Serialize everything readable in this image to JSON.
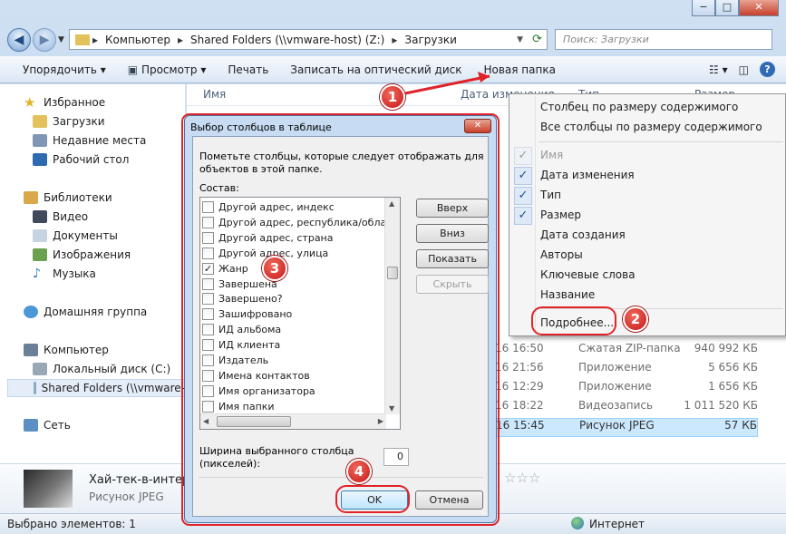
{
  "window": {
    "min": "−",
    "max": "□",
    "close": "✕"
  },
  "nav": {
    "back": "◀",
    "forward": "▶"
  },
  "address": {
    "parts": [
      "Компьютер",
      "Shared Folders (\\\\vmware-host) (Z:)",
      "Загрузки"
    ],
    "sep": "▸"
  },
  "search": {
    "placeholder": "Поиск: Загрузки"
  },
  "toolbar": {
    "organize": "Упорядочить",
    "preview": "Просмотр",
    "print": "Печать",
    "burn": "Записать на оптический диск",
    "newfolder": "Новая папка"
  },
  "sidebar": {
    "favorites": "Избранное",
    "downloads": "Загрузки",
    "recent": "Недавние места",
    "desktop": "Рабочий стол",
    "libraries": "Библиотеки",
    "video": "Видео",
    "documents": "Документы",
    "images": "Изображения",
    "music": "Музыка",
    "homegroup": "Домашняя группа",
    "computer": "Компьютер",
    "localdisk": "Локальный диск (C:)",
    "shared": "Shared Folders (\\\\vmware-",
    "network": "Сеть"
  },
  "columns": {
    "name": "Имя",
    "date": "Дата изменения",
    "type": "Тип",
    "size": "Размер"
  },
  "rows": [
    {
      "date": "16 16:50",
      "type": "Сжатая ZIP-папка",
      "size": "940 992 КБ"
    },
    {
      "date": "16 21:56",
      "type": "Приложение",
      "size": "5 656 КБ"
    },
    {
      "date": "16 12:29",
      "type": "Приложение",
      "size": "1 656 КБ"
    },
    {
      "date": "16 18:22",
      "type": "Видеозапись",
      "size": "1 011 520 КБ"
    },
    {
      "date": "16 15:45",
      "type": "Рисунок JPEG",
      "size": "57 КБ"
    }
  ],
  "details": {
    "filename": "Хай-тек-в-интерь",
    "filetype": "Рисунок JPEG",
    "stars": "☆☆☆"
  },
  "status": {
    "selected": "Выбрано элементов: 1",
    "zone": "Интернет"
  },
  "context_menu": {
    "items": [
      "Столбец по размеру содержимого",
      "Все столбцы по размеру содержимого",
      "Имя",
      "Дата изменения",
      "Тип",
      "Размер",
      "Дата создания",
      "Авторы",
      "Ключевые слова",
      "Название",
      "Подробнее..."
    ],
    "check": "✓"
  },
  "dialog": {
    "title": "Выбор столбцов в таблице",
    "close": "✕",
    "instruction1": "Пометьте столбцы, которые следует отображать для",
    "instruction2": "объектов в этой папке.",
    "composition": "Состав:",
    "items": [
      {
        "label": "Другой адрес, индекс",
        "checked": false
      },
      {
        "label": "Другой адрес, республика/область/к",
        "checked": false
      },
      {
        "label": "Другой адрес, страна",
        "checked": false
      },
      {
        "label": "Другой адрес, улица",
        "checked": false
      },
      {
        "label": "Жанр",
        "checked": true
      },
      {
        "label": "Завершена",
        "checked": false
      },
      {
        "label": "Завершено?",
        "checked": false
      },
      {
        "label": "Зашифровано",
        "checked": false
      },
      {
        "label": "ИД альбома",
        "checked": false
      },
      {
        "label": "ИД клиента",
        "checked": false
      },
      {
        "label": "Издатель",
        "checked": false
      },
      {
        "label": "Имена контактов",
        "checked": false
      },
      {
        "label": "Имя организатора",
        "checked": false
      },
      {
        "label": "Имя папки",
        "checked": false
      }
    ],
    "up": "Вверх",
    "down": "Вниз",
    "show": "Показать",
    "hide": "Скрыть",
    "width_label1": "Ширина выбранного столбца",
    "width_label2": "(пикселей):",
    "width_value": "0",
    "ok": "OK",
    "cancel": "Отмена"
  },
  "badges": [
    "1",
    "2",
    "3",
    "4"
  ],
  "colors": {
    "badge": "#d9252a",
    "ring": "#e0232a",
    "selection": "#cce8ff"
  }
}
